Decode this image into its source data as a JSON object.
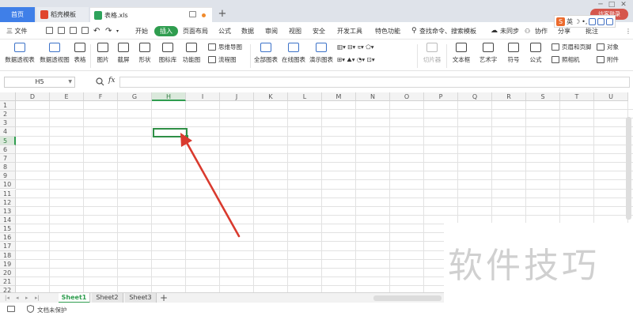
{
  "tabs": {
    "home": "首页",
    "docer": "稻壳模板",
    "file": "表格.xls",
    "new_tab": "+"
  },
  "window": {
    "minimize": "─",
    "maximize": "□",
    "close": "✕",
    "login": "访客登录"
  },
  "ime": {
    "logo": "S",
    "lang": "英",
    "moon": "☽",
    "dot": "•,"
  },
  "menu": {
    "file": "三 文件",
    "items": [
      "开始",
      "插入",
      "页面布局",
      "公式",
      "数据",
      "审阅",
      "视图",
      "安全",
      "开发工具",
      "特色功能"
    ],
    "active_index": 1,
    "search": "查找命令、搜索模板",
    "sync": "未同步",
    "collab": "协作",
    "share": "分享",
    "comment": "批注"
  },
  "ribbon": {
    "pivot_table": "数据透视表",
    "pivot_chart": "数据透视图",
    "table": "表格",
    "picture": "图片",
    "screenshot": "截屏",
    "shapes": "形状",
    "icon_lib": "图标库",
    "func_chart": "功能图",
    "mindmap": "思维导图",
    "flowchart": "流程图",
    "all_charts": "全部图表",
    "online_charts": "在线图表",
    "demo_charts": "演示图表",
    "slicer": "切片器",
    "textbox": "文本框",
    "wordart": "艺术字",
    "symbol": "符号",
    "formula": "公式",
    "header_footer": "页眉和页脚",
    "camera": "照相机",
    "object": "对象",
    "attachment": "附件"
  },
  "formula_bar": {
    "name_box": "H5",
    "fx": "fx",
    "value": ""
  },
  "grid": {
    "columns": [
      "D",
      "E",
      "F",
      "G",
      "H",
      "I",
      "J",
      "K",
      "L",
      "M",
      "N",
      "O",
      "P",
      "Q",
      "R",
      "S",
      "T",
      "U"
    ],
    "rows": [
      "1",
      "2",
      "3",
      "4",
      "5",
      "6",
      "7",
      "8",
      "9",
      "10",
      "11",
      "12",
      "13",
      "14",
      "15",
      "16",
      "17",
      "18",
      "19",
      "20",
      "21",
      "22"
    ],
    "active_column": "H",
    "active_row": "5"
  },
  "sheets": {
    "tabs": [
      "Sheet1",
      "Sheet2",
      "Sheet3"
    ],
    "active": "Sheet1",
    "add": "+"
  },
  "status": {
    "protection": "文档未保护"
  },
  "watermark": {
    "text": "软件技巧"
  },
  "colors": {
    "accent_green": "#2f9d4f",
    "home_tab_blue": "#3f7fe8",
    "annotation_red": "#d93a2e"
  },
  "annotation": {
    "arrow": "red-arrow-pointing-to-H5"
  }
}
